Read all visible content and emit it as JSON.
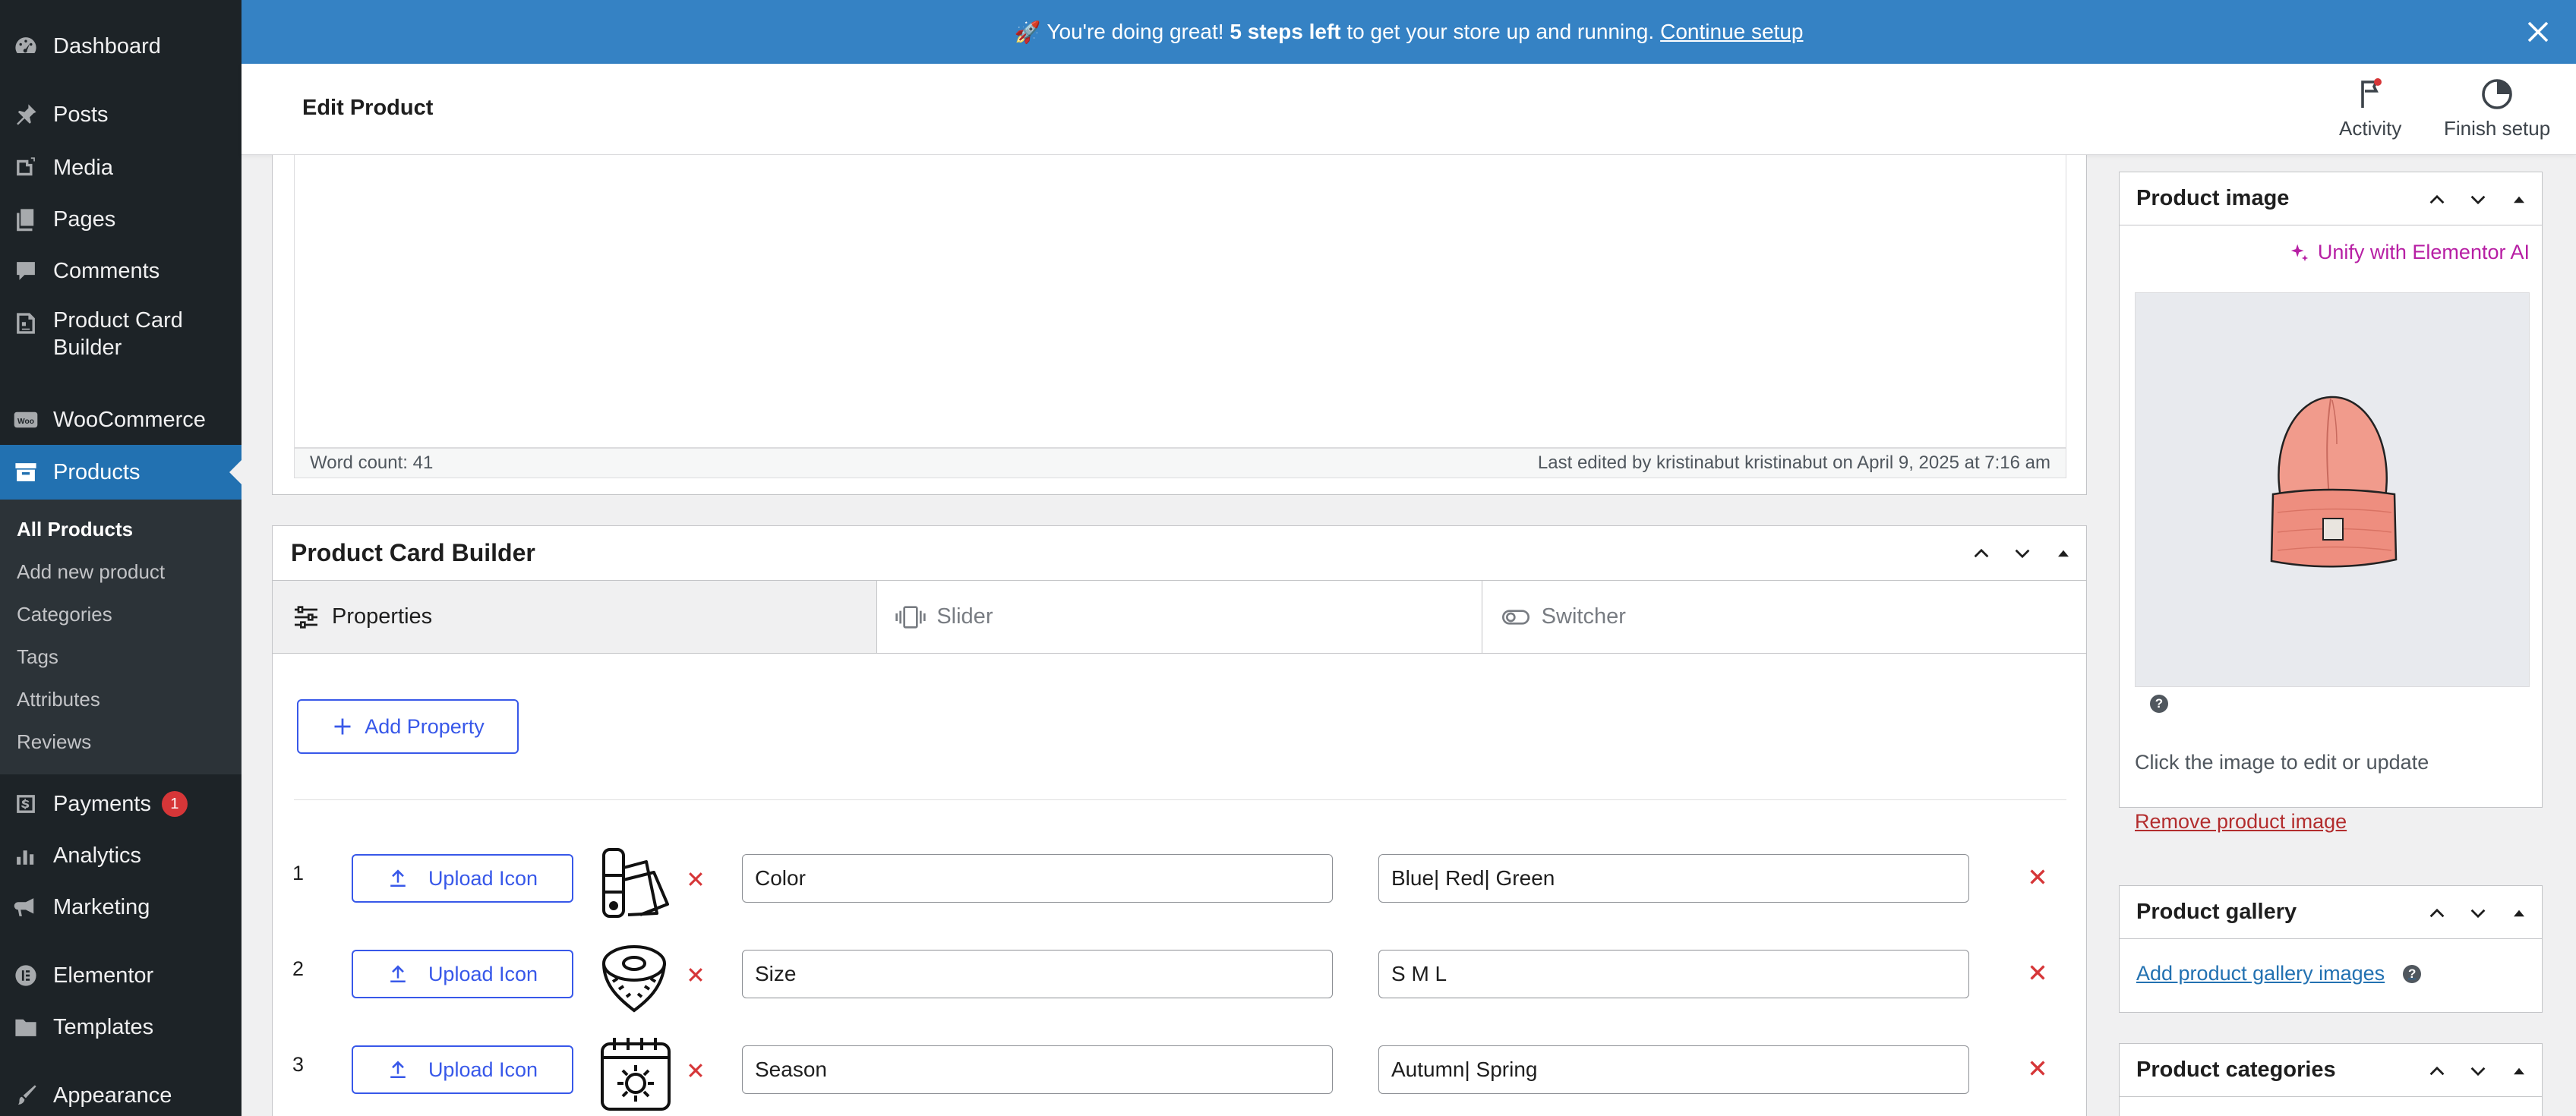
{
  "sidebar": {
    "items": [
      {
        "label": "Dashboard",
        "icon": "dashboard-icon"
      },
      {
        "label": "Posts",
        "icon": "pin-icon"
      },
      {
        "label": "Media",
        "icon": "media-icon"
      },
      {
        "label": "Pages",
        "icon": "page-icon"
      },
      {
        "label": "Comments",
        "icon": "comment-icon"
      },
      {
        "label": "Product Card Builder",
        "icon": "card-builder-icon"
      },
      {
        "label": "WooCommerce",
        "icon": "woo-icon"
      },
      {
        "label": "Products",
        "icon": "archive-icon"
      },
      {
        "label": "Payments",
        "icon": "dollar-icon",
        "badge": "1"
      },
      {
        "label": "Analytics",
        "icon": "chart-bar-icon"
      },
      {
        "label": "Marketing",
        "icon": "megaphone-icon"
      },
      {
        "label": "Elementor",
        "icon": "elementor-icon"
      },
      {
        "label": "Templates",
        "icon": "folder-icon"
      },
      {
        "label": "Appearance",
        "icon": "brush-icon"
      }
    ],
    "submenu": [
      "All Products",
      "Add new product",
      "Categories",
      "Tags",
      "Attributes",
      "Reviews"
    ]
  },
  "notice": {
    "emoji": "🚀",
    "text_before": "You're doing great! ",
    "bold": "5 steps left",
    "text_after": " to get your store up and running.",
    "link": "Continue setup"
  },
  "header": {
    "title": "Edit Product",
    "activity": "Activity",
    "finish_setup": "Finish setup"
  },
  "editor": {
    "word_count": "Word count: 41",
    "last_edited": "Last edited by kristinabut kristinabut on April 9, 2025 at 7:16 am"
  },
  "pcb": {
    "title": "Product Card Builder",
    "tabs": [
      "Properties",
      "Slider",
      "Switcher"
    ],
    "add_property": "Add Property",
    "upload_label": "Upload Icon",
    "rows": [
      {
        "num": "1",
        "name": "Color",
        "value": "Blue| Red| Green",
        "icon": "color-swatch-icon"
      },
      {
        "num": "2",
        "name": "Size",
        "value": "S M L",
        "icon": "measuring-tape-icon"
      },
      {
        "num": "3",
        "name": "Season",
        "value": "Autumn| Spring",
        "icon": "calendar-sun-icon"
      }
    ]
  },
  "side": {
    "product_image": "Product image",
    "unify": "Unify with Elementor AI",
    "hint": "Click the image to edit or update",
    "remove": "Remove product image",
    "gallery": "Product gallery",
    "add_gallery": "Add product gallery images",
    "categories": "Product categories"
  },
  "colors": {
    "accent": "#2271b1",
    "notice": "#3582c4",
    "sidebar": "#1d2327",
    "button": "#3858e9",
    "danger": "#d63638",
    "ai": "#b71fa4"
  }
}
